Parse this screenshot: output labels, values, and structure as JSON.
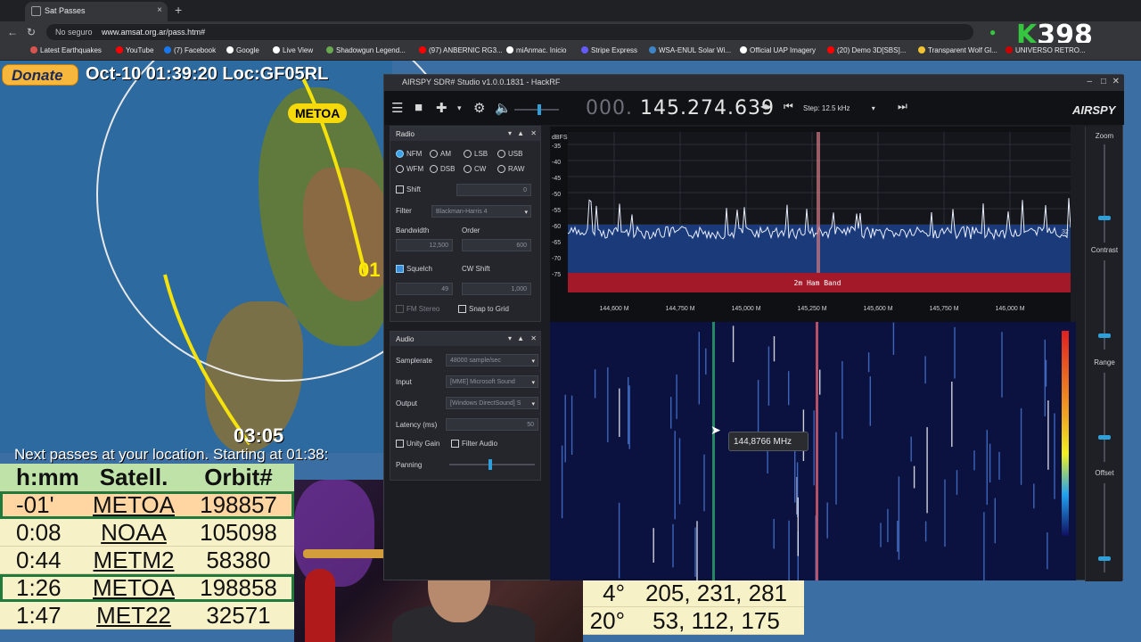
{
  "browser": {
    "tab_title": "Sat Passes",
    "new_tab": "+",
    "close_tab": "×",
    "insecure_label": "No seguro",
    "url": "www.amsat.org.ar/pass.htm#",
    "bookmarks": [
      {
        "label": "Latest Earthquakes",
        "color": "#d9534f"
      },
      {
        "label": "YouTube",
        "color": "#ff0000"
      },
      {
        "label": "(7) Facebook",
        "color": "#1877f2"
      },
      {
        "label": "Google",
        "color": "#ffffff"
      },
      {
        "label": "Live View",
        "color": "#ffffff"
      },
      {
        "label": "Shadowgun Legend...",
        "color": "#6aa84f"
      },
      {
        "label": "(97) ANBERNIC RG3...",
        "color": "#ff0000"
      },
      {
        "label": "miAnmac. Inicio",
        "color": "#ffffff"
      },
      {
        "label": "Stripe Express",
        "color": "#635bff"
      },
      {
        "label": "WSA-ENUL Solar Wi...",
        "color": "#3d85c6"
      },
      {
        "label": "Official UAP Imagery",
        "color": "#ffffff"
      },
      {
        "label": "(20) Demo 3D[SBS]...",
        "color": "#ff0000"
      },
      {
        "label": "Transparent Wolf Gl...",
        "color": "#f1c232"
      },
      {
        "label": "UNIVERSO RETRO...",
        "color": "#cc0000"
      }
    ],
    "badge": {
      "k": "K",
      "num": "398"
    }
  },
  "amsat": {
    "donate": "Donate",
    "clock": "Oct-10 01:39:20  Loc:GF05RL",
    "sat_label": "METOA",
    "track_time": "03:05",
    "partial_num": "01",
    "passes_title": "Next passes at your location. Starting at 01:38:",
    "table_headers": [
      "h:mm",
      "Satell.",
      "Orbit#"
    ],
    "rows": [
      {
        "time": "-01'",
        "sat": "METOA",
        "orbit": "198857"
      },
      {
        "time": "0:08",
        "sat": "NOAA",
        "orbit": "105098"
      },
      {
        "time": "0:44",
        "sat": "METM2",
        "orbit": "58380"
      },
      {
        "time": "1:26",
        "sat": "METOA",
        "orbit": "198858"
      },
      {
        "time": "1:47",
        "sat": "MET22",
        "orbit": "32571"
      }
    ],
    "right_rows": [
      {
        "elev": "4°",
        "az": "205, 231, 281"
      },
      {
        "elev": "20°",
        "az": "53, 112, 175"
      }
    ]
  },
  "airspy": {
    "title": "AIRSPY SDR# Studio v1.0.0.1831 - HackRF",
    "freq_dim": "000.",
    "freq": "145.274.639",
    "step": "Step: 12.5 kHz",
    "logo": "AIRSPY",
    "radio_panel": {
      "title": "Radio",
      "modes": [
        "NFM",
        "AM",
        "LSB",
        "USB",
        "WFM",
        "DSB",
        "CW",
        "RAW"
      ],
      "selected_mode": "NFM",
      "shift_label": "Shift",
      "shift_value": "0",
      "filter_label": "Filter",
      "filter_value": "Blackman-Harris 4",
      "bandwidth_label": "Bandwidth",
      "order_label": "Order",
      "bandwidth_value": "12,500",
      "order_value": "600",
      "squelch_label": "Squelch",
      "cwshift_label": "CW Shift",
      "squelch_value": "49",
      "cwshift_value": "1,000",
      "fmstereo_label": "FM Stereo",
      "snap_label": "Snap to Grid"
    },
    "audio_panel": {
      "title": "Audio",
      "samplerate_label": "Samplerate",
      "samplerate_value": "48000 sample/sec",
      "input_label": "Input",
      "input_value": "[MME] Microsoft Sound",
      "output_label": "Output",
      "output_value": "[Windows DirectSound] S",
      "latency_label": "Latency (ms)",
      "latency_value": "50",
      "unity_label": "Unity Gain",
      "filter_audio_label": "Filter Audio",
      "panning_label": "Panning"
    },
    "spectrum": {
      "db_unit": "dBFS",
      "db_ticks": [
        "-35",
        "-40",
        "-45",
        "-50",
        "-55",
        "-60",
        "-65",
        "-70",
        "-75"
      ],
      "freq_ticks": [
        "144,600 M",
        "144,750 M",
        "145,000 M",
        "145,250 M",
        "145,600 M",
        "145,750 M",
        "146,000 M"
      ],
      "band_label": "2m Ham Band",
      "level_marker": "32"
    },
    "tooltip": "144,8766 MHz",
    "side": {
      "zoom": "Zoom",
      "contrast": "Contrast",
      "range": "Range",
      "offset": "Offset"
    }
  }
}
